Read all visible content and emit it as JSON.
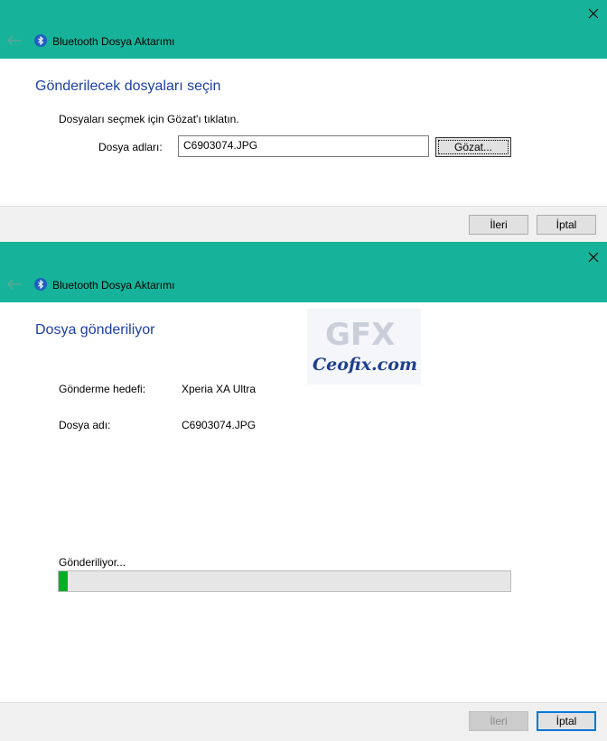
{
  "dialog1": {
    "title": "Bluetooth Dosya Aktarımı",
    "heading": "Gönderilecek dosyaları seçin",
    "instruction": "Dosyaları seçmek için Gözat'ı tıklatın.",
    "file_label": "Dosya adları:",
    "file_value": "C6903074.JPG",
    "browse_label": "Gözat...",
    "next_label": "İleri",
    "cancel_label": "İptal"
  },
  "dialog2": {
    "title": "Bluetooth Dosya Aktarımı",
    "heading": "Dosya gönderiliyor",
    "target_label": "Gönderme hedefi:",
    "target_value": "Xperia XA Ultra",
    "file_label": "Dosya adı:",
    "file_value": "C6903074.JPG",
    "status": "Gönderiliyor...",
    "progress_fraction": 0.02,
    "next_label": "İleri",
    "cancel_label": "İptal"
  },
  "watermark": {
    "logo_text": "GFX",
    "site_text": "Ceofix.com"
  },
  "colors": {
    "titlebar": "#16b39a",
    "heading": "#1c3fa8",
    "progress": "#06b025"
  },
  "icons": [
    "close-icon",
    "back-arrow-icon",
    "bluetooth-icon"
  ]
}
